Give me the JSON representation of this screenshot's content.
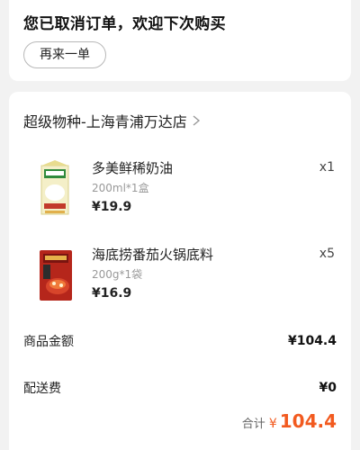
{
  "status": {
    "title": "您已取消订单，欢迎下次购买",
    "reorder_label": "再来一单"
  },
  "store": {
    "name": "超级物种-上海青浦万达店"
  },
  "items": [
    {
      "name": "多美鲜稀奶油",
      "spec": "200ml*1盒",
      "price": "¥19.9",
      "qty": "x1",
      "icon": "cream-carton-thumbnail"
    },
    {
      "name": "海底捞番茄火锅底料",
      "spec": "200g*1袋",
      "price": "¥16.9",
      "qty": "x5",
      "icon": "hotpot-base-thumbnail"
    }
  ],
  "summary": {
    "goods_label": "商品金额",
    "goods_value": "¥104.4",
    "delivery_label": "配送费",
    "delivery_value": "¥0",
    "total_label": "合计",
    "total_currency": "¥",
    "total_amount": "104.4"
  },
  "colors": {
    "accent": "#f25a1f",
    "background": "#f2f2f2"
  }
}
